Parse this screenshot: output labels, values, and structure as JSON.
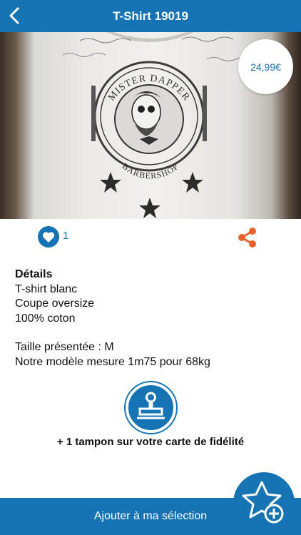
{
  "header": {
    "title": "T-Shirt 19019",
    "back_icon": "chevron-left-icon"
  },
  "product": {
    "image_alt": "MISTER DAPPER BARBERSHOP",
    "logo_top_text": "MISTER DAPPER",
    "logo_bottom_text": "BARBERSHOP",
    "price": "24,99€"
  },
  "actions": {
    "like_icon": "heart-icon",
    "like_count": "1",
    "share_icon": "share-icon"
  },
  "details": {
    "heading": "Détails",
    "lines": [
      "T-shirt blanc",
      "Coupe oversize",
      "100% coton"
    ],
    "size_line": "Taille présentée : M",
    "model_line": "Notre modèle mesure 1m75 pour 68kg"
  },
  "loyalty": {
    "icon": "stamp-icon",
    "text": "+ 1 tampon sur votre carte de fidélité"
  },
  "footer": {
    "add_label": "Ajouter à ma sélection",
    "fav_icon": "star-plus-icon"
  },
  "colors": {
    "primary": "#1673b4",
    "share": "#e8612c",
    "white": "#ffffff"
  }
}
